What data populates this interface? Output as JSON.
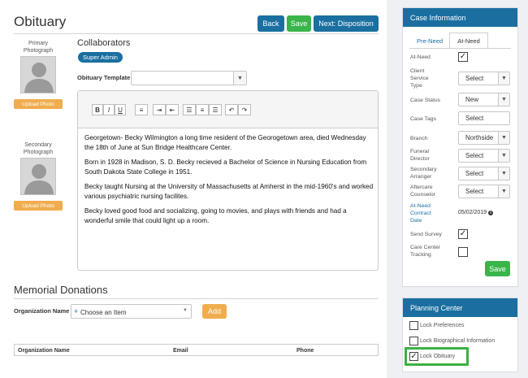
{
  "page": {
    "title": "Obituary"
  },
  "actions": {
    "back": "Back",
    "save": "Save",
    "next": "Next: Disposition"
  },
  "photos": {
    "primary_label": "Primary\nPhotograph",
    "secondary_label": "Secondary\nPhotograph",
    "upload_label": "Upload Photo"
  },
  "collaborators": {
    "title": "Collaborators",
    "badge": "Super Admin"
  },
  "template": {
    "label": "Obituary Template",
    "value": ""
  },
  "editor": {
    "toolbar": [
      "B",
      "I",
      "U",
      "list-bulleted",
      "indent",
      "outdent",
      "align-left",
      "align-center",
      "align-right",
      "undo",
      "redo"
    ],
    "paragraphs": [
      "Georgetown- Becky Wilmington a long time resident of the Georogetown area, died Wednesday the 18th of June at Sun Bridge Healthcare Center.",
      "Born in 1928 in Madison, S. D. Becky recieved a Bachelor of Science in Nursing Education from South Dakota State College in 1951.",
      "Becky taught Nursing at the University of Massachusetts at Amherst in the mid-1960's and worked various psychiatric nursing facilites.",
      "Becky loved good food and socializing, going to movies, and plays with friends and had a wonderful smile that could light up a room."
    ]
  },
  "donations": {
    "title": "Memorial Donations",
    "org_label": "Organization Name",
    "org_placeholder": "Choose an Item",
    "add_label": "Add",
    "columns": [
      "Organization Name",
      "Email",
      "Phone"
    ]
  },
  "case_info": {
    "title": "Case Information",
    "tabs": [
      "Pre-Need",
      "At-Need"
    ],
    "active_tab": "At-Need",
    "fields": {
      "at_need": {
        "label": "At-Need",
        "checked": true
      },
      "client_service_type": {
        "label": "Client\nService\nType",
        "value": "Select"
      },
      "case_status": {
        "label": "Case Status",
        "value": "New"
      },
      "case_tags": {
        "label": "Case Tags",
        "value": "Select"
      },
      "branch": {
        "label": "Branch",
        "value": "Northside"
      },
      "funeral_director": {
        "label": "Funeral\nDirector",
        "value": "Select"
      },
      "secondary_arranger": {
        "label": "Secondary\nArranger",
        "value": "Select"
      },
      "aftercare_counselor": {
        "label": "Aftercare\nCounselor",
        "value": "Select"
      },
      "contract_date": {
        "label": "At-Need\nContract\nDate",
        "value": "05/02/2019"
      },
      "send_survey": {
        "label": "Send Survey",
        "checked": true
      },
      "care_center": {
        "label": "Care Center\nTracking",
        "checked": false
      }
    },
    "save_label": "Save"
  },
  "planning_center": {
    "title": "Planning Center",
    "items": [
      {
        "label": "Lock Preferences",
        "checked": false
      },
      {
        "label": "Lock Biographical Information",
        "checked": false
      },
      {
        "label": "Lock Obituary",
        "checked": true
      }
    ]
  },
  "colors": {
    "primary": "#1a6fa0",
    "success": "#39b54a",
    "warning": "#f0ad4e",
    "highlight": "#3cb043"
  }
}
